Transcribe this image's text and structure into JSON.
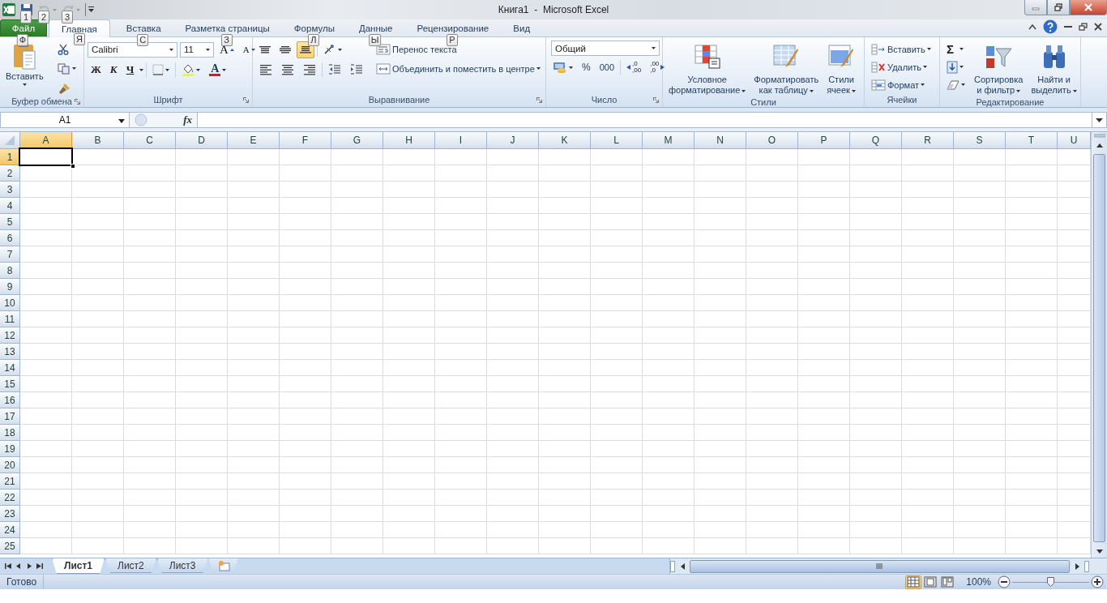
{
  "title_bar": {
    "title": "Книга1  -  Microsoft Excel",
    "quick_access": [
      {
        "kind": "save",
        "keytip": "1",
        "disabled": false
      },
      {
        "kind": "undo",
        "keytip": "2",
        "disabled": true
      },
      {
        "kind": "redo",
        "keytip": "3",
        "disabled": true
      }
    ]
  },
  "tabs": [
    {
      "label": "Файл",
      "kind": "file",
      "selected": false,
      "keytip": "Ф"
    },
    {
      "label": "Главная",
      "kind": "tab",
      "selected": true,
      "keytip": "Я"
    },
    {
      "label": "Вставка",
      "kind": "tab",
      "selected": false,
      "keytip": "С"
    },
    {
      "label": "Разметка страницы",
      "kind": "tab",
      "selected": false,
      "keytip": "З"
    },
    {
      "label": "Формулы",
      "kind": "tab",
      "selected": false,
      "keytip": "Л"
    },
    {
      "label": "Данные",
      "kind": "tab",
      "selected": false,
      "keytip": "Ы"
    },
    {
      "label": "Рецензирование",
      "kind": "tab",
      "selected": false,
      "keytip": "Р"
    },
    {
      "label": "Вид",
      "kind": "tab",
      "selected": false
    }
  ],
  "ribbon": {
    "clipboard": {
      "label": "Буфер обмена",
      "paste": "Вставить"
    },
    "font": {
      "label": "Шрифт",
      "font_name": "Calibri",
      "font_size": "11",
      "grow": "A",
      "shrink": "A",
      "bold": "Ж",
      "italic": "К",
      "underline": "Ч",
      "font_color": "A"
    },
    "alignment": {
      "label": "Выравнивание",
      "vertical": [
        {
          "kind": "top",
          "selected": false
        },
        {
          "kind": "middle",
          "selected": false
        },
        {
          "kind": "bottom",
          "selected": true
        }
      ],
      "horizontal": [
        {
          "kind": "left",
          "selected": false
        },
        {
          "kind": "center",
          "selected": false
        },
        {
          "kind": "right",
          "selected": false
        }
      ],
      "wrap_text": "Перенос текста",
      "merge": "Объединить и поместить в центре"
    },
    "number": {
      "label": "Число",
      "format": "Общий",
      "percent": "%",
      "thousands": "000",
      "increase_decimal": [
        ",0",
        ",00"
      ],
      "decrease_decimal": [
        ",00",
        ",0"
      ]
    },
    "styles": {
      "label": "Стили",
      "buttons": [
        {
          "kind": "conditional",
          "lines": [
            "Условное",
            "форматирование"
          ]
        },
        {
          "kind": "table",
          "lines": [
            "Форматировать",
            "как таблицу"
          ]
        },
        {
          "kind": "cell_styles",
          "lines": [
            "Стили",
            "ячеек"
          ]
        }
      ]
    },
    "cells": {
      "label": "Ячейки",
      "buttons": [
        {
          "kind": "insert",
          "label": "Вставить"
        },
        {
          "kind": "delete",
          "label": "Удалить"
        },
        {
          "kind": "format",
          "label": "Формат"
        }
      ]
    },
    "editing": {
      "label": "Редактирование",
      "sum": "Σ",
      "buttons": [
        {
          "kind": "sort",
          "lines": [
            "Сортировка",
            "и фильтр"
          ]
        },
        {
          "kind": "find",
          "lines": [
            "Найти и",
            "выделить"
          ]
        }
      ]
    }
  },
  "formula_bar": {
    "name_box": "A1",
    "fx": "fx"
  },
  "sheet": {
    "columns": [
      {
        "label": "A",
        "selected": true
      },
      {
        "label": "B",
        "selected": false
      },
      {
        "label": "C",
        "selected": false
      },
      {
        "label": "D",
        "selected": false
      },
      {
        "label": "E",
        "selected": false
      },
      {
        "label": "F",
        "selected": false
      },
      {
        "label": "G",
        "selected": false
      },
      {
        "label": "H",
        "selected": false
      },
      {
        "label": "I",
        "selected": false
      },
      {
        "label": "J",
        "selected": false
      },
      {
        "label": "K",
        "selected": false
      },
      {
        "label": "L",
        "selected": false
      },
      {
        "label": "M",
        "selected": false
      },
      {
        "label": "N",
        "selected": false
      },
      {
        "label": "O",
        "selected": false
      },
      {
        "label": "P",
        "selected": false
      },
      {
        "label": "Q",
        "selected": false
      },
      {
        "label": "R",
        "selected": false
      },
      {
        "label": "S",
        "selected": false
      },
      {
        "label": "T",
        "selected": false
      },
      {
        "label": "U",
        "selected": false
      }
    ],
    "rows": [
      {
        "label": "1",
        "selected": true
      },
      {
        "label": "2",
        "selected": false
      },
      {
        "label": "3",
        "selected": false
      },
      {
        "label": "4",
        "selected": false
      },
      {
        "label": "5",
        "selected": false
      },
      {
        "label": "6",
        "selected": false
      },
      {
        "label": "7",
        "selected": false
      },
      {
        "label": "8",
        "selected": false
      },
      {
        "label": "9",
        "selected": false
      },
      {
        "label": "10",
        "selected": false
      },
      {
        "label": "11",
        "selected": false
      },
      {
        "label": "12",
        "selected": false
      },
      {
        "label": "13",
        "selected": false
      },
      {
        "label": "14",
        "selected": false
      },
      {
        "label": "15",
        "selected": false
      },
      {
        "label": "16",
        "selected": false
      },
      {
        "label": "17",
        "selected": false
      },
      {
        "label": "18",
        "selected": false
      },
      {
        "label": "19",
        "selected": false
      },
      {
        "label": "20",
        "selected": false
      },
      {
        "label": "21",
        "selected": false
      },
      {
        "label": "22",
        "selected": false
      },
      {
        "label": "23",
        "selected": false
      },
      {
        "label": "24",
        "selected": false
      },
      {
        "label": "25",
        "selected": false
      }
    ]
  },
  "sheet_tabs": [
    {
      "label": "Лист1",
      "selected": true
    },
    {
      "label": "Лист2",
      "selected": false
    },
    {
      "label": "Лист3",
      "selected": false
    }
  ],
  "status_bar": {
    "status": "Готово",
    "views": [
      {
        "kind": "normal",
        "selected": true
      },
      {
        "kind": "page_layout",
        "selected": false
      },
      {
        "kind": "page_break",
        "selected": false
      }
    ],
    "zoom": "100%",
    "zoom_slider": {
      "level": 0.5
    }
  }
}
